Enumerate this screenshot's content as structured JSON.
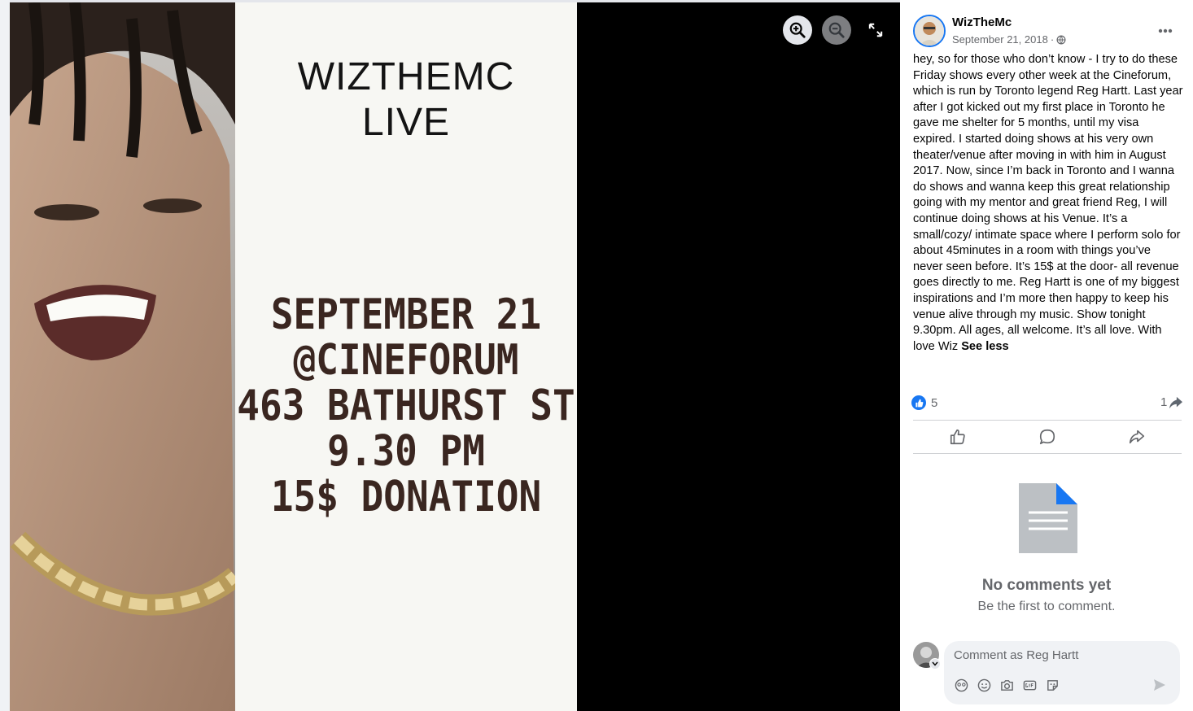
{
  "viewer": {
    "poster": {
      "title_line1": "WIZTHEMC",
      "title_line2": "LIVE",
      "lines": [
        "SEPTEMBER 21",
        "@CINEFORUM",
        "463 BATHURST ST",
        "9.30 PM",
        "15$ DONATION"
      ]
    },
    "controls": {
      "zoom_in_icon": "zoom-in-icon",
      "zoom_out_icon": "zoom-out-icon",
      "fullscreen_icon": "fullscreen-icon"
    }
  },
  "post": {
    "author": "WizTheMc",
    "date": "September 21, 2018",
    "separator": "·",
    "privacy_icon": "globe-icon",
    "text": "hey, so for those who don’t know - I try to do these Friday shows every other week at the Cineforum, which is run by Toronto legend Reg Hartt. Last year after I got kicked out my first place in Toronto he gave me shelter for 5 months, until my visa expired. I started doing shows at his very own theater/venue after moving in with him in August 2017. Now, since I’m back in Toronto and I wanna do shows and wanna keep this great relationship going with my mentor and great friend Reg, I will continue doing shows at his Venue. It’s a small/cozy/ intimate space where I perform solo for about 45minutes in a room with things you’ve never seen before. It’s 15$ at the door- all revenue goes directly to me. Reg Hartt is one of my biggest inspirations and I’m more then happy to keep his venue alive through my music. Show tonight 9.30pm. All ages, all welcome. It’s all love. With love Wiz",
    "see_less": "See less",
    "reaction_count": "5",
    "share_count": "1"
  },
  "comments": {
    "empty_title": "No comments yet",
    "empty_subtitle": "Be the first to comment.",
    "input_placeholder": "Comment as Reg Hartt"
  },
  "colors": {
    "accent": "#1877f2",
    "viewer_bg": "#000000",
    "poster_text": "#3a2620"
  }
}
